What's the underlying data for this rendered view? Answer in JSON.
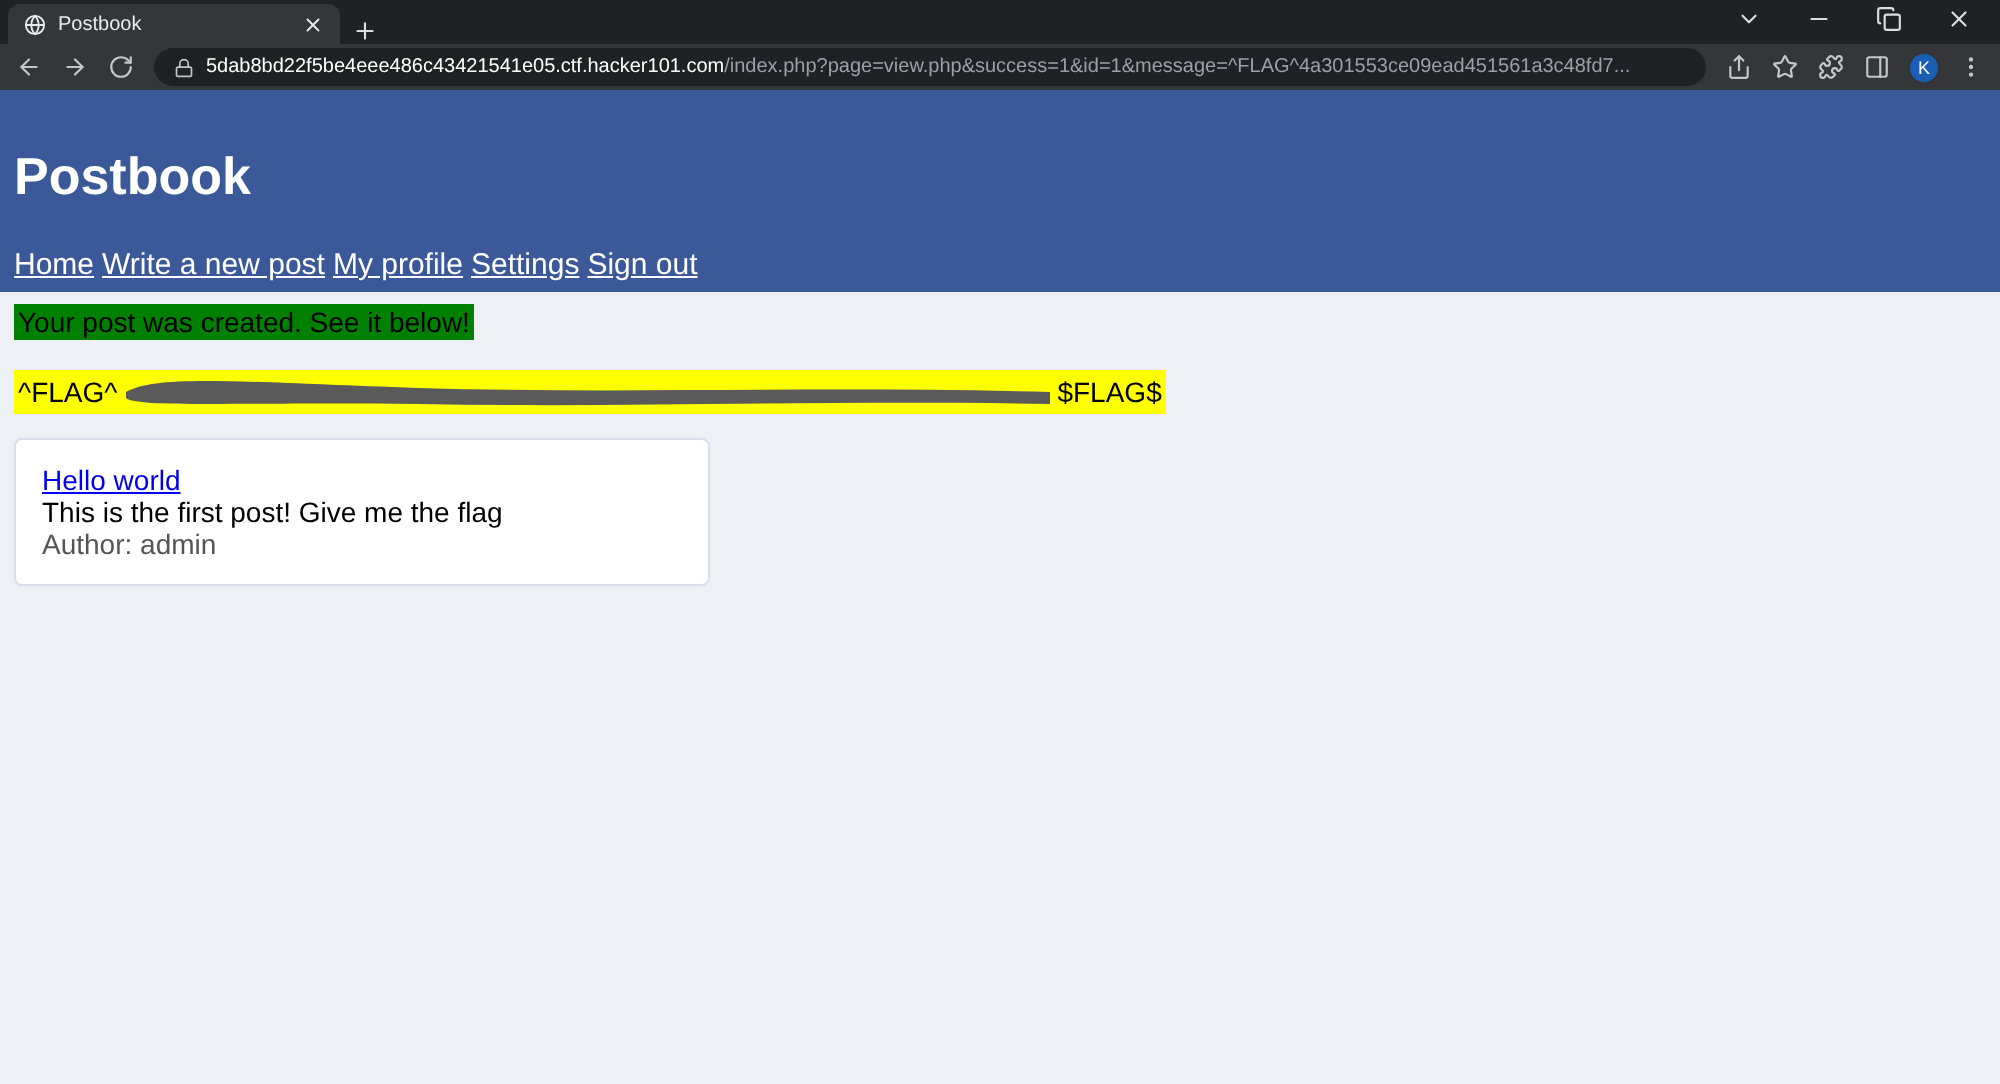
{
  "browser": {
    "tab": {
      "title": "Postbook"
    },
    "url": {
      "host": "5dab8bd22f5be4eee486c43421541e05.ctf.hacker101.com",
      "path": "/index.php?page=view.php&success=1&id=1&message=^FLAG^4a301553ce09ead451561a3c48fd7..."
    },
    "profile_initial": "K"
  },
  "site": {
    "title": "Postbook",
    "nav": [
      "Home",
      "Write a new post",
      "My profile",
      "Settings",
      "Sign out"
    ]
  },
  "success_message": "Your post was created. See it below!",
  "flag": {
    "start": "^FLAG^",
    "end": "$FLAG$",
    "redacted": true
  },
  "posts": [
    {
      "title": "Hello world",
      "body": "This is the first post! Give me the flag",
      "author": "Author: admin"
    }
  ]
}
